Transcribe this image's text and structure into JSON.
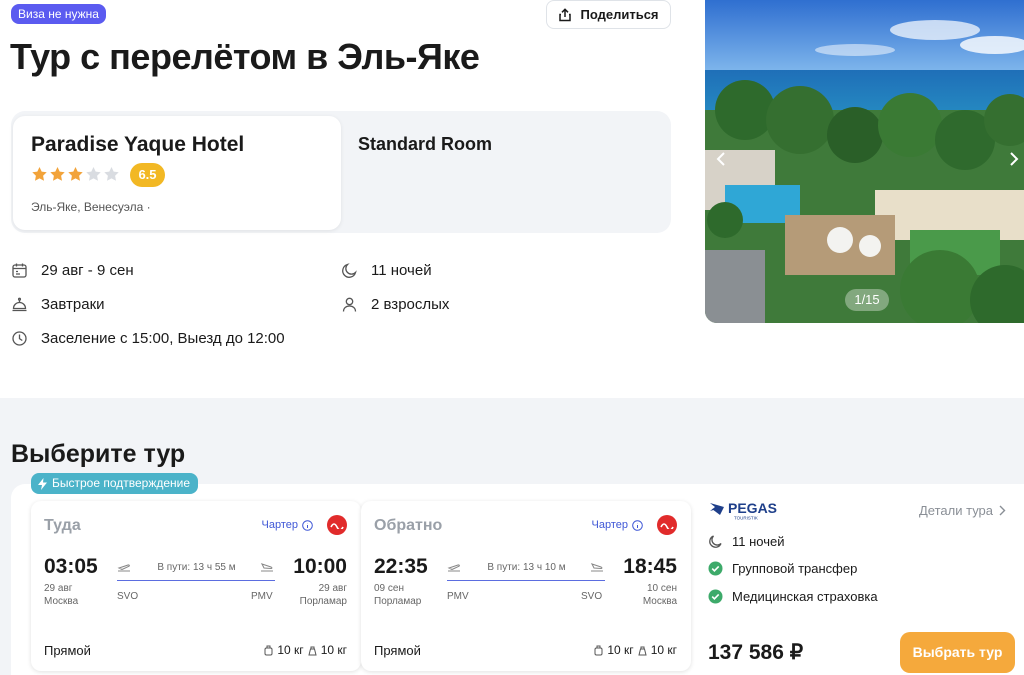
{
  "header": {
    "visa_badge": "Виза не нужна",
    "share_label": "Поделиться",
    "title": "Тур с перелётом в Эль-Яке"
  },
  "hotel": {
    "name": "Paradise Yaque Hotel",
    "stars": 3,
    "stars_max": 5,
    "rating": "6.5",
    "location": "Эль-Яке, Венесуэла ·",
    "room": "Standard Room"
  },
  "facts": {
    "dates": "29 авг - 9 сен",
    "nights": "11 ночей",
    "meals": "Завтраки",
    "guests": "2 взрослых",
    "checkin": "Заселение с 15:00, Выезд до 12:00"
  },
  "photo": {
    "counter": "1/15",
    "icons": {
      "prev": "chevron-left-icon",
      "next": "chevron-right-icon"
    }
  },
  "tours": {
    "section_title": "Выберите тур",
    "fast_badge": "Быстрое подтверждение",
    "outbound": {
      "direction": "Туда",
      "charter": "Чартер",
      "dep_time": "03:05",
      "arr_time": "10:00",
      "duration": "В пути: 13 ч 55 м",
      "dep_date": "29 авг",
      "dep_city": "Москва",
      "arr_date": "29 авг",
      "arr_city": "Порламар",
      "dep_code": "SVO",
      "arr_code": "PMV",
      "direct": "Прямой",
      "bag_hand": "10 кг",
      "bag_checked": "10 кг"
    },
    "return": {
      "direction": "Обратно",
      "charter": "Чартер",
      "dep_time": "22:35",
      "arr_time": "18:45",
      "duration": "В пути: 13 ч 10 м",
      "dep_date": "09 сен",
      "dep_city": "Порламар",
      "arr_date": "10 сен",
      "arr_city": "Москва",
      "dep_code": "PMV",
      "arr_code": "SVO",
      "direct": "Прямой",
      "bag_hand": "10 кг",
      "bag_checked": "10 кг"
    },
    "operator": {
      "logo_text": "PEGAS",
      "logo_sub": "TOURISTIK",
      "details": "Детали тура",
      "nights": "11 ночей",
      "transfer": "Групповой трансфер",
      "insurance": "Медицинская страховка",
      "price": "137 586 ₽",
      "choose": "Выбрать тур"
    }
  },
  "colors": {
    "visa_badge": "#5b5bf0",
    "rating_badge": "#f2b824",
    "star_filled": "#f2a33a",
    "star_empty": "#d9dce1",
    "fast_badge": "#4bb3c9",
    "charter_link": "#3f57d6",
    "airline_red": "#e12b2b",
    "check_green": "#3daa6a",
    "choose_button": "#f5a93c",
    "lower_bg": "#f2f4f7"
  }
}
